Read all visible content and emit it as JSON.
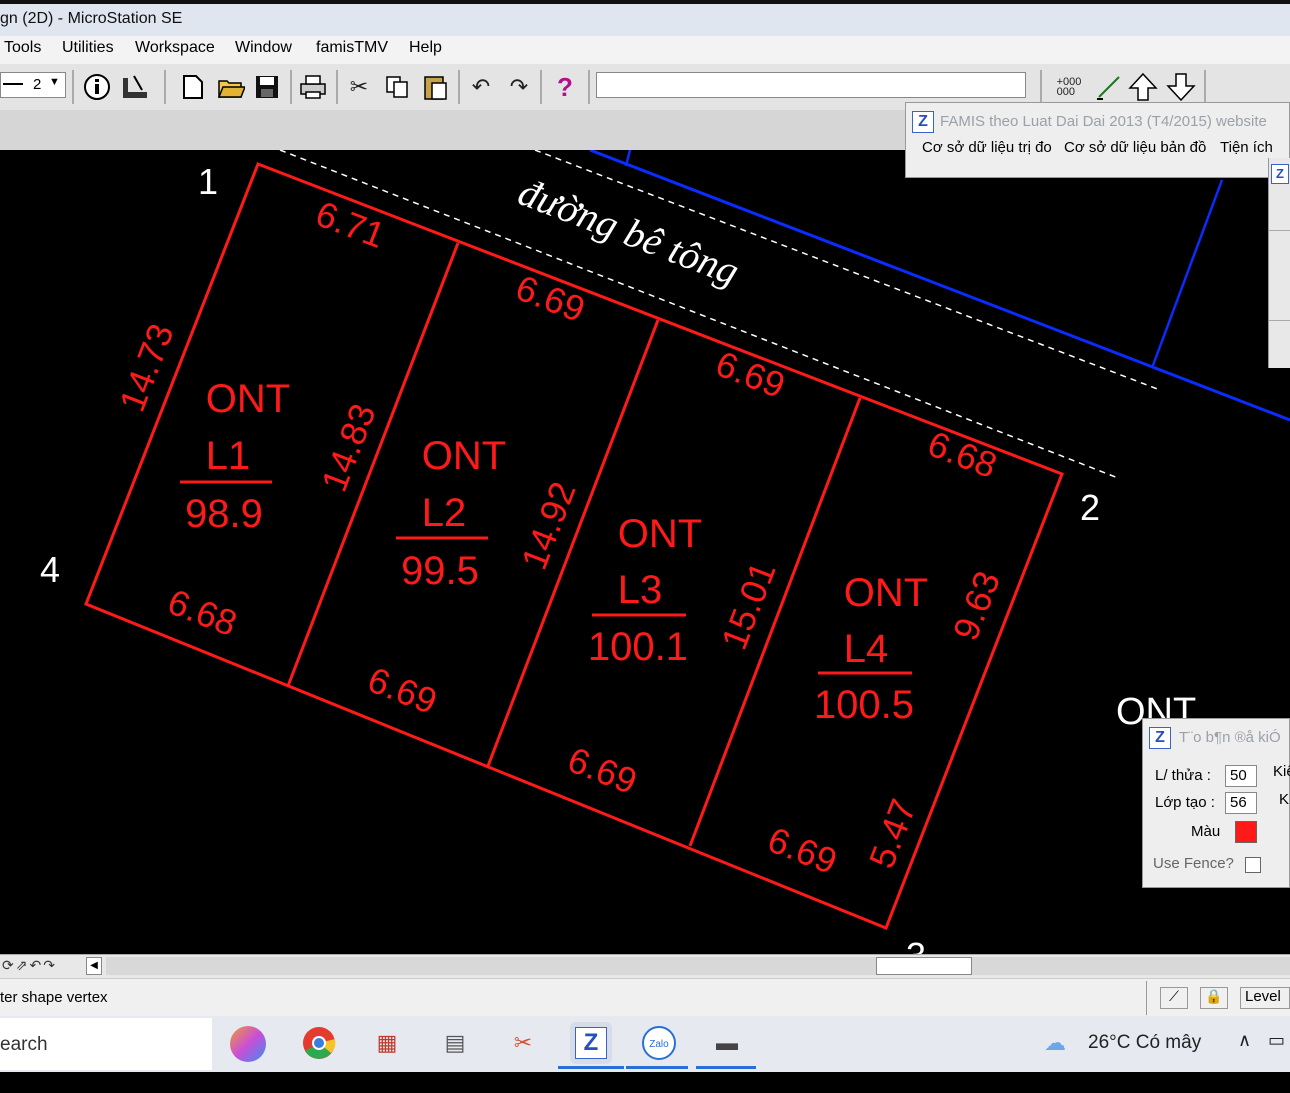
{
  "window": {
    "title": "gn (2D) - MicroStation SE"
  },
  "menu": [
    "Tools",
    "Utilities",
    "Workspace",
    "Window",
    "famisTMV",
    "Help"
  ],
  "toolbar": {
    "line_weight_value": "2"
  },
  "famis_panel": {
    "title": "FAMIS theo Luat Dai Dai 2013 (T4/2015)  website",
    "menu": [
      "Cơ sở dữ liệu trị đo",
      "Cơ sở dữ liệu bản đồ",
      "Tiện ích"
    ]
  },
  "drawing": {
    "road_label": "đường bê tông",
    "corner_labels": [
      "1",
      "2",
      "3",
      "4"
    ],
    "lots": [
      {
        "use": "ONT",
        "id": "L1",
        "area": "98.9"
      },
      {
        "use": "ONT",
        "id": "L2",
        "area": "99.5"
      },
      {
        "use": "ONT",
        "id": "L3",
        "area": "100.1"
      },
      {
        "use": "ONT",
        "id": "L4",
        "area": "100.5"
      }
    ],
    "top_edges": [
      "6.71",
      "6.69",
      "6.69",
      "6.68"
    ],
    "bottom_edges": [
      "6.68",
      "6.69",
      "6.69",
      "6.69"
    ],
    "side_edges": [
      "14.73",
      "14.83",
      "14.92",
      "15.01",
      "9.63",
      "5.47"
    ],
    "stray_label": "ONT",
    "colors": {
      "parcel": "#ff1a1a",
      "road_line": "#0a2cff",
      "background": "#000000"
    }
  },
  "tao_panel": {
    "title": "T¨o b¶n ®å kiÓ",
    "lt_thua_label": "L/ thửa :",
    "lt_thua_value": "50",
    "lop_tao_label": "Lớp tạo :",
    "lop_tao_value": "56",
    "mau_label": "Màu",
    "mau_color": "#ff1a1a",
    "use_fence_label": "Use Fence?",
    "k1": "Kiể",
    "k2": "Ki"
  },
  "status": {
    "prompt": "ter shape vertex",
    "level_label": "Level"
  },
  "taskbar": {
    "search": "earch",
    "weather": "26°C  Có mây"
  }
}
